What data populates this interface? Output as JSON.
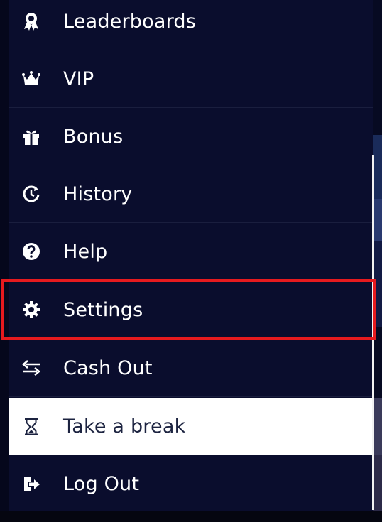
{
  "menu": {
    "items": [
      {
        "id": "leaderboards",
        "label": "Leaderboards",
        "icon": "ribbon-badge-icon"
      },
      {
        "id": "vip",
        "label": "VIP",
        "icon": "crown-icon"
      },
      {
        "id": "bonus",
        "label": "Bonus",
        "icon": "gift-icon"
      },
      {
        "id": "history",
        "label": "History",
        "icon": "history-icon"
      },
      {
        "id": "help",
        "label": "Help",
        "icon": "question-circle-icon"
      },
      {
        "id": "settings",
        "label": "Settings",
        "icon": "gear-icon",
        "highlighted": true
      },
      {
        "id": "cash-out",
        "label": "Cash Out",
        "icon": "swap-arrows-icon"
      },
      {
        "id": "take-a-break",
        "label": "Take a break",
        "icon": "hourglass-icon",
        "active": true
      },
      {
        "id": "log-out",
        "label": "Log Out",
        "icon": "logout-icon"
      }
    ]
  },
  "colors": {
    "menu_bg": "#0a0d2d",
    "text": "#ffffff",
    "active_bg": "#ffffff",
    "active_text": "#1c2340",
    "highlight": "#e61a1e"
  }
}
